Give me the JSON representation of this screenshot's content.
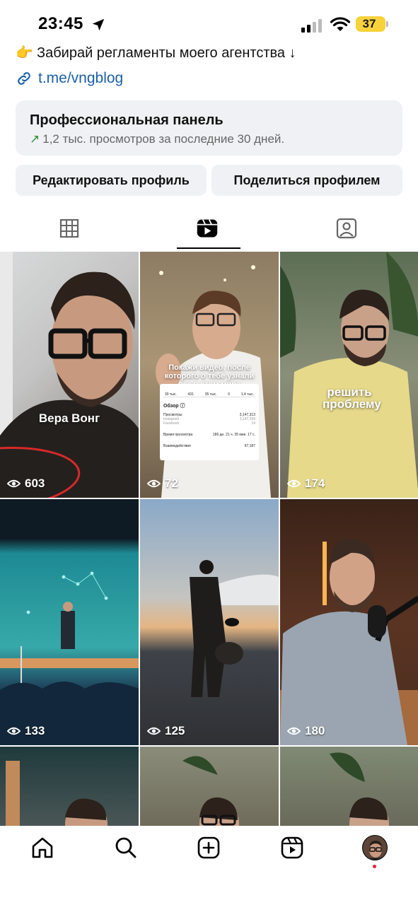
{
  "status_bar": {
    "time": "23:45",
    "battery": "37",
    "battery_color": "#f7d23a"
  },
  "bio": {
    "emoji": "👉",
    "text": "Забирай регламенты моего агентства ↓",
    "link": "t.me/vngblog"
  },
  "pro_panel": {
    "title": "Профессиональная панель",
    "arrow": "↗",
    "subtitle": "1,2 тыс. просмотров за последние 30 дней."
  },
  "buttons": {
    "edit": "Редактировать профиль",
    "share": "Поделиться профилем"
  },
  "tabs": {
    "active": "reels",
    "icons": [
      "grid-icon",
      "reels-icon",
      "tagged-icon"
    ]
  },
  "reels": [
    {
      "views": "603",
      "caption": "Вера Вонг"
    },
    {
      "views": "72",
      "caption": "Покажи видео, после которого о тебе узнали все в этом мире"
    },
    {
      "views": "174",
      "caption": "решить проблему"
    },
    {
      "views": "133",
      "caption": ""
    },
    {
      "views": "125",
      "caption": ""
    },
    {
      "views": "180",
      "caption": ""
    }
  ],
  "stats_card": {
    "stats": [
      "30 тыс.",
      "431",
      "35 тыс.",
      "0",
      "1,4 тыс."
    ],
    "title": "Обзор ⓘ",
    "rows": [
      {
        "label": "Просмотры",
        "value": "3,147,313"
      },
      {
        "label": "Instagram",
        "value": "3,147,299"
      },
      {
        "label": "Facebook",
        "value": "14"
      },
      {
        "label": "Время просмотра",
        "value": "186 дн. 21 ч. 35 мин. 17 с."
      },
      {
        "label": "Взаимодействия",
        "value": "67,187"
      }
    ]
  },
  "tabbar": {
    "icons": [
      "home-icon",
      "search-icon",
      "create-icon",
      "reels-icon",
      "profile-avatar"
    ]
  }
}
